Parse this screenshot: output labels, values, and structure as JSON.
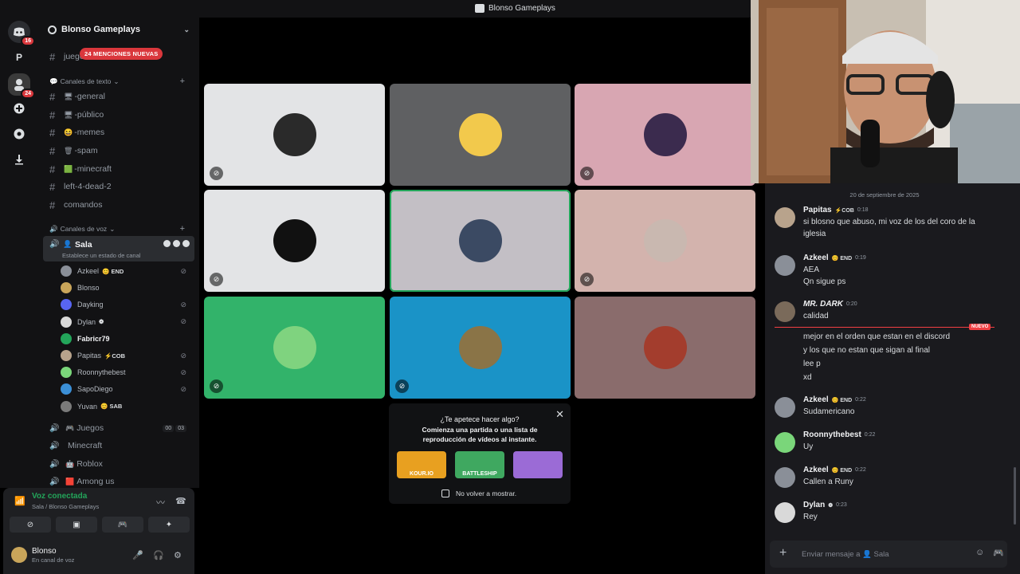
{
  "window": {
    "title": "Blonso Gameplays"
  },
  "rail": {
    "servers": [
      {
        "icon": "discord-home-icon",
        "badge": "16"
      },
      {
        "letter": "P"
      },
      {
        "icon": "server-blonso-icon",
        "badge": "24"
      },
      {
        "icon": "add-server-icon"
      },
      {
        "icon": "discover-icon"
      },
      {
        "icon": "download-icon"
      }
    ]
  },
  "server": {
    "name": "Blonso Gameplays",
    "mentions_pill": "24 MENCIONES NUEVAS",
    "top_channel": "juego",
    "text_category": "Canales de texto",
    "text_channels": [
      {
        "emoji": "🖥",
        "name": "-general"
      },
      {
        "emoji": "🖥",
        "name": "-público"
      },
      {
        "emoji": "😆",
        "name": "-memes"
      },
      {
        "emoji": "🗑",
        "name": "-spam"
      },
      {
        "emoji": "🟩",
        "name": "-minecraft"
      },
      {
        "emoji": "",
        "name": "left-4-dead-2"
      },
      {
        "emoji": "",
        "name": "comandos"
      }
    ],
    "voice_category": "Canales de voz",
    "active_voice": {
      "name": "Sala",
      "status_hint": "Establece un estado de canal"
    },
    "voice_users": [
      {
        "name": "Azkeel",
        "tag": "😊 END",
        "color": "#8a8f98"
      },
      {
        "name": "Blonso",
        "tag": "",
        "color": "#c9a55a"
      },
      {
        "name": "Dayking",
        "tag": "",
        "color": "#5865f2"
      },
      {
        "name": "Dylan",
        "tag": "❁",
        "color": "#d9d9d9"
      },
      {
        "name": "Fabricr79",
        "tag": "",
        "color": "#23a55a"
      },
      {
        "name": "Papitas",
        "tag": "⚡COB",
        "color": "#b8a38c"
      },
      {
        "name": "Roonnythebest",
        "tag": "",
        "color": "#7ad67a"
      },
      {
        "name": "SapoDiego",
        "tag": "",
        "color": "#3b8fd6"
      },
      {
        "name": "Yuvan",
        "tag": "😊 SAB",
        "color": "#7a7a7a"
      }
    ],
    "other_voice": [
      {
        "emoji": "🎮",
        "name": "Juegos",
        "count_a": "00",
        "count_b": "03"
      },
      {
        "emoji": "",
        "name": "Minecraft"
      },
      {
        "emoji": "🤖",
        "name": "Roblox"
      },
      {
        "emoji": "🟥",
        "name": "Among us"
      }
    ]
  },
  "voice_panel": {
    "status": "Voz conectada",
    "location": "Sala / Blonso Gameplays"
  },
  "user": {
    "name": "Blonso",
    "status": "En canal de voz"
  },
  "tiles": [
    {
      "bg": "#e3e4e6",
      "pfp": "#2a2a2a",
      "muted": true,
      "mute_icon": "camera-off-icon"
    },
    {
      "bg": "#5f6062",
      "pfp": "#f2c94c",
      "muted": false
    },
    {
      "bg": "#d8a6b2",
      "pfp": "#3b2b4e",
      "muted": true
    },
    {
      "bg": "#e3e4e6",
      "pfp": "#111111",
      "muted": true
    },
    {
      "bg": "#c3bfc5",
      "pfp": "#3b4a63",
      "muted": false,
      "speaking": true
    },
    {
      "bg": "#d3b3ad",
      "pfp": "#c9b8b0",
      "muted": true
    },
    {
      "bg": "#32b36a",
      "pfp": "#7fd37f",
      "muted": true
    },
    {
      "bg": "#1a93c7",
      "pfp": "#8a7447",
      "muted": true
    },
    {
      "bg": "#8a6c6c",
      "pfp": "#a33d2d",
      "muted": false
    }
  ],
  "popup": {
    "question": "¿Te apetece hacer algo?",
    "description": "Comienza una partida o una lista de reproducción de vídeos al instante.",
    "games": [
      {
        "label": "KOUR.IO",
        "color": "#e8a020"
      },
      {
        "label": "BATTLESHIP",
        "color": "#3fa860"
      },
      {
        "label": "",
        "color": "#9b6bd6"
      }
    ],
    "checkbox_label": "No volver a mostrar."
  },
  "chat": {
    "date": "20 de septiembre de 2025",
    "new_tag": "NUEVO",
    "messages": [
      {
        "author": "Papitas",
        "role": "⚡COB",
        "time": "0:18",
        "lines": [
          "si blosno que abuso, mi voz de los del coro de la",
          "iglesia"
        ],
        "av": "#b8a38c"
      },
      {
        "author": "Azkeel",
        "role": "😊 END",
        "time": "0:19",
        "lines": [
          "AEA",
          "Qn sigue ps"
        ],
        "av": "#8a8f98"
      },
      {
        "author": "MR. DARK",
        "role": "",
        "time": "0:20",
        "lines": [
          "calidad"
        ],
        "av": "#7a6a5a"
      },
      {
        "author": "",
        "role": "",
        "time": "",
        "lines": [
          "mejor en el orden que estan en el discord",
          "y los que no estan que sigan al final",
          "lee p",
          "xd"
        ],
        "av": ""
      },
      {
        "author": "Azkeel",
        "role": "😊 END",
        "time": "0:22",
        "lines": [
          "Sudamericano"
        ],
        "av": "#8a8f98"
      },
      {
        "author": "Roonnythebest",
        "role": "",
        "time": "0:22",
        "lines": [
          "Uy"
        ],
        "av": "#7ad67a"
      },
      {
        "author": "Azkeel",
        "role": "😊 END",
        "time": "0:22",
        "lines": [
          "Callen a Runy"
        ],
        "av": "#8a8f98"
      },
      {
        "author": "Dylan",
        "role": "❁",
        "time": "0:23",
        "lines": [
          "Rey"
        ],
        "av": "#d9d9d9"
      }
    ],
    "composer_placeholder": "Enviar mensaje a 👤 Sala"
  }
}
